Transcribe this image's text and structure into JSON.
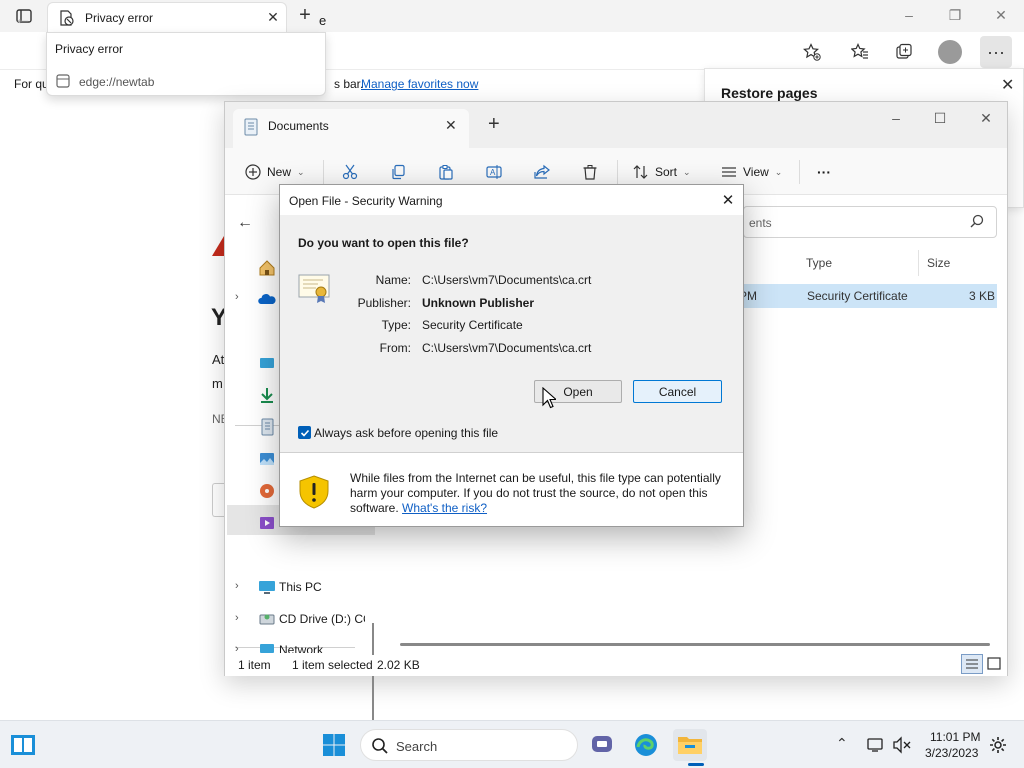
{
  "browser": {
    "tab_title": "Privacy error",
    "dropdown_title": "Privacy error",
    "dropdown_url": "edge://newtab",
    "address_fragment": "e",
    "favbar_prefix": "For qu",
    "favbar_middle": "s bar.",
    "favbar_link": "Manage favorites now",
    "restore_title": "Restore pages",
    "error_fragments": [
      "Y",
      "At",
      "m",
      "NE"
    ]
  },
  "explorer": {
    "tab_title": "Documents",
    "commands": {
      "new": "New",
      "sort": "Sort",
      "view": "View",
      "more": "···"
    },
    "search_placeholder": "ents",
    "columns": {
      "type": "Type",
      "size": "Size"
    },
    "file": {
      "time": "PM",
      "type": "Security Certificate",
      "size": "3 KB"
    },
    "nav": {
      "this_pc": "This PC",
      "cd_drive": "CD Drive (D:) CC",
      "network": "Network"
    },
    "status": {
      "items": "1 item",
      "selected": "1 item selected",
      "size": "2.02 KB"
    }
  },
  "dialog": {
    "title": "Open File - Security Warning",
    "question": "Do you want to open this file?",
    "labels": {
      "name": "Name:",
      "publisher": "Publisher:",
      "type": "Type:",
      "from": "From:"
    },
    "values": {
      "name": "C:\\Users\\vm7\\Documents\\ca.crt",
      "publisher": "Unknown Publisher",
      "type": "Security Certificate",
      "from": "C:\\Users\\vm7\\Documents\\ca.crt"
    },
    "open_button": "Open",
    "cancel_button": "Cancel",
    "checkbox_label": "Always ask before opening this file",
    "checkbox_checked": true,
    "warning_text": "While files from the Internet can be useful, this file type can potentially harm your computer. If you do not trust the source, do not open this software.",
    "risk_link": "What's the risk?"
  },
  "taskbar": {
    "search_label": "Search",
    "time": "11:01 PM",
    "date": "3/23/2023"
  },
  "colors": {
    "accent": "#005fb8",
    "link": "#0f5fc5",
    "selection": "#cce4f7",
    "warning_shield": "#f5c400"
  }
}
